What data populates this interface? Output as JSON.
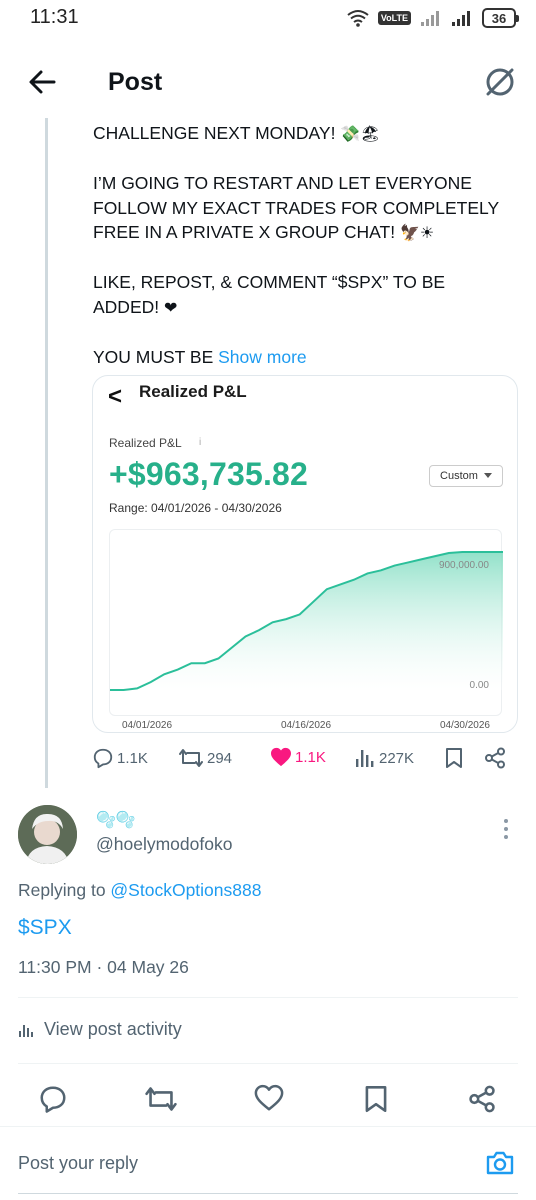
{
  "status_bar": {
    "time": "11:31",
    "network_badge": "VoLTE",
    "battery": "36"
  },
  "header": {
    "title": "Post",
    "back_icon": "arrow-left-icon",
    "grok_icon": "grok-icon"
  },
  "tweet": {
    "paragraphs": [
      {
        "text": "CHALLENGE NEXT MONDAY! ",
        "emoji": "💸🏖"
      },
      {
        "text": "I’M GOING TO RESTART AND LET EVERYONE FOLLOW MY EXACT TRADES FOR COMPLETELY FREE IN A PRIVATE X GROUP CHAT! ",
        "emoji": "🦅☀"
      },
      {
        "text": "LIKE, REPOST, & COMMENT “$SPX” TO BE ADDED! ",
        "emoji": "❤"
      }
    ],
    "truncated_text": "YOU MUST BE ",
    "show_more": "Show more",
    "media": {
      "title": "Realized P&L",
      "back_glyph": "<",
      "label": "Realized P&L",
      "info_glyph": "i",
      "value": "+$963,735.82",
      "value_color": "#27b08a",
      "filter": "Custom",
      "range": "Range: 04/01/2026 - 04/30/2026",
      "chart_data": {
        "type": "area",
        "x_tick_labels": [
          "04/01/2026",
          "04/16/2026",
          "04/30/2026"
        ],
        "y_tick_labels": [
          "900,000.00",
          "0.00"
        ],
        "ylim": [
          0,
          1000000
        ],
        "x": [
          "04/01",
          "04/02",
          "04/03",
          "04/04",
          "04/05",
          "04/06",
          "04/07",
          "04/08",
          "04/09",
          "04/10",
          "04/11",
          "04/12",
          "04/13",
          "04/14",
          "04/15",
          "04/16",
          "04/17",
          "04/18",
          "04/19",
          "04/20",
          "04/21",
          "04/22",
          "04/23",
          "04/24",
          "04/25",
          "04/26",
          "04/27",
          "04/28",
          "04/29",
          "04/30"
        ],
        "values": [
          0,
          0,
          10000,
          50000,
          100000,
          130000,
          170000,
          170000,
          200000,
          270000,
          340000,
          380000,
          430000,
          450000,
          480000,
          560000,
          640000,
          670000,
          700000,
          740000,
          760000,
          790000,
          810000,
          830000,
          850000,
          870000,
          880000,
          900000,
          920000,
          963735.82
        ],
        "line_color": "#2bbf9a",
        "fill_color": "#c8efe3"
      }
    },
    "stats": {
      "replies": "1.1K",
      "reposts": "294",
      "likes": "1.1K",
      "views": "227K"
    }
  },
  "reply": {
    "display_name": "🫧🫧",
    "handle": "@hoelymodofoko",
    "replying_prefix": "Replying to ",
    "replying_to": "@StockOptions888",
    "text": "$SPX",
    "timestamp": "11:30 PM · 04 May 26",
    "activity": "View post activity"
  },
  "compose": {
    "placeholder": "Post your reply"
  },
  "colors": {
    "link": "#1d9bf0",
    "muted": "#536471",
    "like": "#f91880"
  }
}
